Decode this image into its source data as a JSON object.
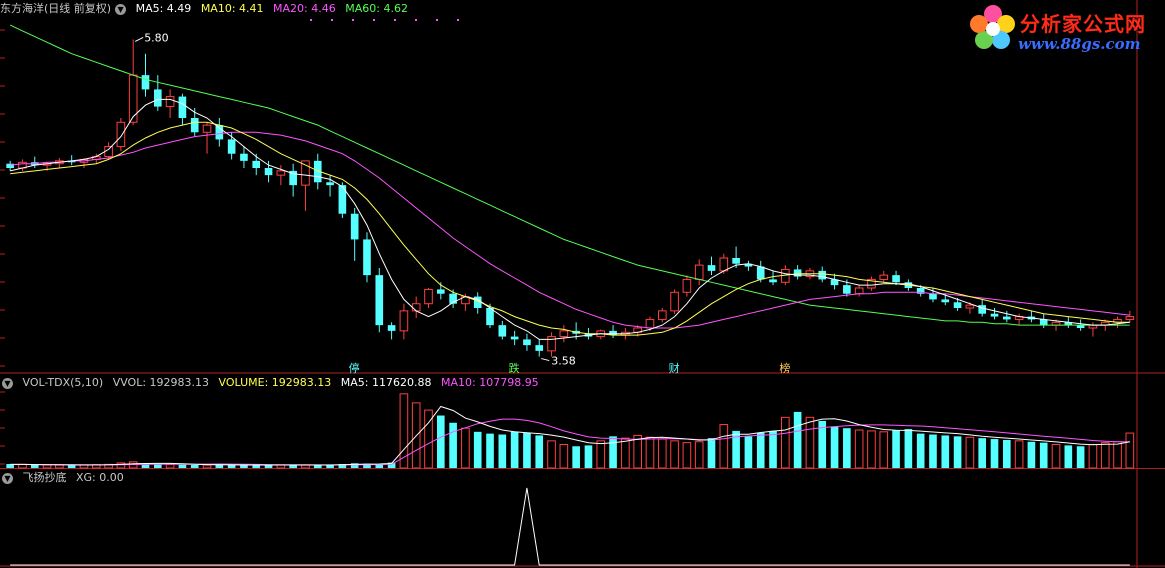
{
  "header": {
    "stock": "东方海洋(日线 前复权)",
    "ma5": "MA5: 4.49",
    "ma10": "MA10: 4.41",
    "ma20": "MA20: 4.46",
    "ma60": "MA60: 4.62"
  },
  "vol_header": {
    "name": "VOL-TDX(5,10)",
    "vvol": "VVOL: 192983.13",
    "volume": "VOLUME: 192983.13",
    "ma5": "MA5: 117620.88",
    "ma10": "MA10: 107798.95"
  },
  "ind_header": {
    "name": "飞扬抄底",
    "xg": "XG: 0.00"
  },
  "logo": {
    "title": "分析家公式网",
    "url": "www.88gs.com"
  },
  "markers": [
    {
      "label": "停",
      "color": "#55ffff"
    },
    {
      "label": "跌",
      "color": "#55ff55"
    },
    {
      "label": "财",
      "color": "#55ffff"
    },
    {
      "label": "榜",
      "color": "#ffcc55"
    }
  ],
  "annotations": {
    "high": "5.80",
    "low": "3.58"
  },
  "colors": {
    "up": "#ff4040",
    "down": "#55ffff",
    "ma5": "#ffffff",
    "ma10": "#ffff55",
    "ma20": "#ff55ff",
    "ma60": "#55ff55"
  },
  "chart_data": {
    "type": "candlestick",
    "price_range": [
      3.5,
      5.95
    ],
    "volume_range": [
      0,
      420000
    ],
    "indicator_range": [
      0,
      1
    ],
    "candles": [
      [
        4.93,
        4.95,
        4.88,
        4.9
      ],
      [
        4.9,
        4.96,
        4.88,
        4.94
      ],
      [
        4.94,
        4.98,
        4.9,
        4.92
      ],
      [
        4.92,
        4.94,
        4.88,
        4.93
      ],
      [
        4.93,
        4.97,
        4.9,
        4.95
      ],
      [
        4.95,
        4.99,
        4.92,
        4.94
      ],
      [
        4.94,
        4.97,
        4.9,
        4.96
      ],
      [
        4.96,
        5.0,
        4.93,
        4.98
      ],
      [
        4.98,
        5.08,
        4.96,
        5.05
      ],
      [
        5.05,
        5.25,
        5.02,
        5.22
      ],
      [
        5.22,
        5.8,
        5.2,
        5.55
      ],
      [
        5.55,
        5.7,
        5.4,
        5.45
      ],
      [
        5.45,
        5.55,
        5.3,
        5.33
      ],
      [
        5.33,
        5.45,
        5.25,
        5.4
      ],
      [
        5.4,
        5.42,
        5.2,
        5.25
      ],
      [
        5.25,
        5.32,
        5.12,
        5.15
      ],
      [
        5.15,
        5.22,
        5.0,
        5.2
      ],
      [
        5.2,
        5.25,
        5.05,
        5.1
      ],
      [
        5.1,
        5.15,
        4.96,
        5.0
      ],
      [
        5.0,
        5.05,
        4.9,
        4.95
      ],
      [
        4.95,
        5.0,
        4.85,
        4.9
      ],
      [
        4.9,
        4.95,
        4.8,
        4.85
      ],
      [
        4.85,
        4.92,
        4.78,
        4.88
      ],
      [
        4.88,
        4.93,
        4.7,
        4.78
      ],
      [
        4.78,
        4.85,
        4.6,
        4.95
      ],
      [
        4.95,
        5.0,
        4.75,
        4.8
      ],
      [
        4.8,
        4.85,
        4.7,
        4.78
      ],
      [
        4.78,
        4.8,
        4.55,
        4.58
      ],
      [
        4.58,
        4.62,
        4.25,
        4.4
      ],
      [
        4.4,
        4.45,
        4.1,
        4.15
      ],
      [
        4.15,
        4.2,
        3.75,
        3.8
      ],
      [
        3.8,
        3.82,
        3.7,
        3.76
      ],
      [
        3.76,
        3.95,
        3.7,
        3.9
      ],
      [
        3.9,
        4.0,
        3.85,
        3.95
      ],
      [
        3.95,
        4.06,
        3.92,
        4.05
      ],
      [
        4.05,
        4.1,
        3.98,
        4.02
      ],
      [
        4.02,
        4.05,
        3.92,
        3.95
      ],
      [
        3.95,
        4.02,
        3.9,
        4.0
      ],
      [
        4.0,
        4.03,
        3.88,
        3.92
      ],
      [
        3.92,
        3.95,
        3.78,
        3.8
      ],
      [
        3.8,
        3.83,
        3.7,
        3.72
      ],
      [
        3.72,
        3.76,
        3.66,
        3.7
      ],
      [
        3.7,
        3.74,
        3.62,
        3.66
      ],
      [
        3.66,
        3.7,
        3.58,
        3.62
      ],
      [
        3.62,
        3.75,
        3.58,
        3.72
      ],
      [
        3.72,
        3.8,
        3.68,
        3.76
      ],
      [
        3.76,
        3.82,
        3.7,
        3.74
      ],
      [
        3.74,
        3.78,
        3.7,
        3.72
      ],
      [
        3.72,
        3.77,
        3.7,
        3.76
      ],
      [
        3.76,
        3.8,
        3.71,
        3.73
      ],
      [
        3.73,
        3.78,
        3.7,
        3.75
      ],
      [
        3.75,
        3.8,
        3.72,
        3.78
      ],
      [
        3.78,
        3.86,
        3.76,
        3.84
      ],
      [
        3.84,
        3.92,
        3.82,
        3.9
      ],
      [
        3.9,
        4.05,
        3.88,
        4.03
      ],
      [
        4.03,
        4.15,
        4.0,
        4.12
      ],
      [
        4.12,
        4.26,
        4.08,
        4.22
      ],
      [
        4.22,
        4.28,
        4.15,
        4.18
      ],
      [
        4.18,
        4.3,
        4.16,
        4.27
      ],
      [
        4.27,
        4.35,
        4.2,
        4.23
      ],
      [
        4.23,
        4.25,
        4.18,
        4.21
      ],
      [
        4.21,
        4.25,
        4.1,
        4.12
      ],
      [
        4.12,
        4.18,
        4.08,
        4.1
      ],
      [
        4.1,
        4.22,
        4.08,
        4.19
      ],
      [
        4.19,
        4.22,
        4.12,
        4.14
      ],
      [
        4.14,
        4.2,
        4.12,
        4.18
      ],
      [
        4.18,
        4.21,
        4.1,
        4.12
      ],
      [
        4.12,
        4.16,
        4.05,
        4.08
      ],
      [
        4.08,
        4.12,
        4.0,
        4.02
      ],
      [
        4.02,
        4.08,
        4.0,
        4.06
      ],
      [
        4.06,
        4.14,
        4.04,
        4.12
      ],
      [
        4.12,
        4.18,
        4.1,
        4.15
      ],
      [
        4.15,
        4.18,
        4.08,
        4.1
      ],
      [
        4.1,
        4.12,
        4.04,
        4.06
      ],
      [
        4.06,
        4.08,
        4.0,
        4.02
      ],
      [
        4.02,
        4.06,
        3.96,
        3.98
      ],
      [
        3.98,
        4.02,
        3.94,
        3.96
      ],
      [
        3.96,
        3.99,
        3.9,
        3.92
      ],
      [
        3.92,
        3.96,
        3.88,
        3.94
      ],
      [
        3.94,
        3.98,
        3.86,
        3.88
      ],
      [
        3.88,
        3.92,
        3.84,
        3.86
      ],
      [
        3.86,
        3.9,
        3.82,
        3.84
      ],
      [
        3.84,
        3.88,
        3.8,
        3.86
      ],
      [
        3.86,
        3.9,
        3.82,
        3.84
      ],
      [
        3.84,
        3.88,
        3.78,
        3.8
      ],
      [
        3.8,
        3.84,
        3.76,
        3.82
      ],
      [
        3.82,
        3.86,
        3.78,
        3.8
      ],
      [
        3.8,
        3.84,
        3.76,
        3.78
      ],
      [
        3.78,
        3.82,
        3.72,
        3.8
      ],
      [
        3.8,
        3.84,
        3.76,
        3.82
      ],
      [
        3.82,
        3.86,
        3.78,
        3.84
      ],
      [
        3.84,
        3.9,
        3.82,
        3.86
      ]
    ],
    "ma5": [
      4.88,
      4.9,
      4.92,
      4.93,
      4.94,
      4.95,
      4.96,
      4.98,
      5.03,
      5.12,
      5.26,
      5.34,
      5.38,
      5.38,
      5.35,
      5.29,
      5.25,
      5.18,
      5.12,
      5.05,
      4.98,
      4.92,
      4.89,
      4.86,
      4.85,
      4.84,
      4.82,
      4.77,
      4.65,
      4.5,
      4.3,
      4.12,
      3.98,
      3.9,
      3.86,
      3.9,
      3.96,
      4.0,
      3.98,
      3.92,
      3.86,
      3.8,
      3.76,
      3.7,
      3.7,
      3.71,
      3.72,
      3.73,
      3.74,
      3.74,
      3.74,
      3.75,
      3.77,
      3.8,
      3.86,
      3.95,
      4.06,
      4.13,
      4.18,
      4.22,
      4.23,
      4.21,
      4.18,
      4.16,
      4.15,
      4.15,
      4.14,
      4.12,
      4.1,
      4.08,
      4.08,
      4.09,
      4.09,
      4.09,
      4.07,
      4.04,
      4.01,
      3.98,
      3.95,
      3.92,
      3.9,
      3.88,
      3.86,
      3.85,
      3.84,
      3.83,
      3.82,
      3.81,
      3.8,
      3.8,
      3.81,
      3.82
    ],
    "ma10": [
      4.86,
      4.87,
      4.88,
      4.89,
      4.9,
      4.91,
      4.92,
      4.93,
      4.96,
      5.0,
      5.06,
      5.11,
      5.15,
      5.18,
      5.2,
      5.22,
      5.22,
      5.2,
      5.18,
      5.14,
      5.1,
      5.05,
      5.0,
      4.96,
      4.92,
      4.88,
      4.85,
      4.82,
      4.76,
      4.68,
      4.58,
      4.47,
      4.36,
      4.26,
      4.16,
      4.08,
      4.03,
      4.0,
      3.97,
      3.93,
      3.9,
      3.86,
      3.83,
      3.8,
      3.78,
      3.77,
      3.75,
      3.74,
      3.74,
      3.73,
      3.73,
      3.73,
      3.74,
      3.75,
      3.78,
      3.83,
      3.89,
      3.95,
      4.0,
      4.05,
      4.09,
      4.12,
      4.14,
      4.15,
      4.16,
      4.16,
      4.16,
      4.15,
      4.14,
      4.12,
      4.11,
      4.1,
      4.09,
      4.08,
      4.07,
      4.06,
      4.04,
      4.02,
      4.0,
      3.98,
      3.96,
      3.94,
      3.92,
      3.9,
      3.88,
      3.87,
      3.86,
      3.85,
      3.84,
      3.83,
      3.82,
      3.82
    ],
    "ma20": [
      4.92,
      4.93,
      4.93,
      4.94,
      4.94,
      4.95,
      4.95,
      4.96,
      4.97,
      4.99,
      5.01,
      5.04,
      5.06,
      5.08,
      5.1,
      5.12,
      5.13,
      5.14,
      5.15,
      5.15,
      5.15,
      5.14,
      5.13,
      5.11,
      5.09,
      5.06,
      5.03,
      5.0,
      4.95,
      4.89,
      4.83,
      4.76,
      4.69,
      4.62,
      4.55,
      4.48,
      4.41,
      4.35,
      4.29,
      4.23,
      4.18,
      4.13,
      4.08,
      4.03,
      3.99,
      3.95,
      3.91,
      3.88,
      3.85,
      3.82,
      3.8,
      3.79,
      3.78,
      3.78,
      3.78,
      3.79,
      3.8,
      3.82,
      3.84,
      3.86,
      3.88,
      3.9,
      3.92,
      3.94,
      3.96,
      3.98,
      3.99,
      4.0,
      4.01,
      4.02,
      4.02,
      4.03,
      4.03,
      4.03,
      4.03,
      4.02,
      4.02,
      4.01,
      4.0,
      3.99,
      3.98,
      3.97,
      3.96,
      3.95,
      3.94,
      3.93,
      3.92,
      3.91,
      3.9,
      3.89,
      3.88,
      3.87
    ],
    "ma60": [
      5.9,
      5.86,
      5.82,
      5.78,
      5.74,
      5.7,
      5.67,
      5.64,
      5.61,
      5.58,
      5.55,
      5.52,
      5.5,
      5.48,
      5.46,
      5.44,
      5.42,
      5.4,
      5.38,
      5.36,
      5.34,
      5.32,
      5.29,
      5.26,
      5.23,
      5.2,
      5.16,
      5.12,
      5.08,
      5.04,
      5.0,
      4.96,
      4.92,
      4.88,
      4.84,
      4.8,
      4.76,
      4.72,
      4.68,
      4.64,
      4.6,
      4.56,
      4.52,
      4.48,
      4.44,
      4.4,
      4.37,
      4.34,
      4.31,
      4.28,
      4.25,
      4.22,
      4.2,
      4.18,
      4.16,
      4.14,
      4.12,
      4.1,
      4.08,
      4.06,
      4.04,
      4.02,
      4.0,
      3.98,
      3.96,
      3.94,
      3.93,
      3.92,
      3.91,
      3.9,
      3.89,
      3.88,
      3.87,
      3.86,
      3.85,
      3.84,
      3.83,
      3.83,
      3.82,
      3.82,
      3.81,
      3.81,
      3.8,
      3.8,
      3.8,
      3.8,
      3.8,
      3.8,
      3.8,
      3.8,
      3.8,
      3.8
    ],
    "volume": [
      22000,
      20000,
      18000,
      17000,
      16000,
      15000,
      17000,
      18000,
      20000,
      28000,
      34000,
      25000,
      22000,
      20000,
      18000,
      17000,
      16000,
      17000,
      18000,
      16000,
      15000,
      16000,
      17000,
      18000,
      16000,
      15000,
      18000,
      22000,
      26000,
      24000,
      20000,
      30000,
      410000,
      360000,
      320000,
      290000,
      250000,
      220000,
      200000,
      190000,
      185000,
      200000,
      195000,
      180000,
      150000,
      130000,
      120000,
      125000,
      150000,
      175000,
      165000,
      180000,
      170000,
      160000,
      150000,
      140000,
      145000,
      165000,
      240000,
      205000,
      175000,
      195000,
      205000,
      280000,
      310000,
      280000,
      260000,
      230000,
      220000,
      210000,
      205000,
      200000,
      210000,
      215000,
      190000,
      185000,
      180000,
      175000,
      170000,
      165000,
      160000,
      155000,
      150000,
      145000,
      140000,
      130000,
      125000,
      120000,
      130000,
      140000,
      145000,
      192983
    ],
    "vol_ma5": [
      20000,
      20000,
      19000,
      18500,
      18000,
      17000,
      16500,
      17000,
      17500,
      20000,
      23000,
      25000,
      25500,
      25500,
      24000,
      20500,
      18600,
      17600,
      17200,
      16800,
      16400,
      16400,
      16400,
      16400,
      16400,
      16400,
      16600,
      17800,
      20000,
      21600,
      22000,
      25000,
      103000,
      178000,
      250000,
      340000,
      318000,
      276000,
      255000,
      230000,
      210000,
      200000,
      195000,
      190000,
      182000,
      171000,
      155000,
      140000,
      135000,
      140000,
      148000,
      159000,
      168000,
      170000,
      165000,
      160000,
      154000,
      156000,
      176000,
      186000,
      186000,
      196000,
      204000,
      210000,
      233000,
      254000,
      270000,
      272000,
      260000,
      240000,
      225000,
      213000,
      209000,
      208000,
      204000,
      199000,
      194000,
      190000,
      183000,
      175000,
      170000,
      165000,
      160000,
      155000,
      150000,
      144000,
      138000,
      132000,
      129000,
      131000,
      132000,
      145000
    ],
    "vol_ma10": [
      20000,
      20000,
      19500,
      19000,
      18500,
      18000,
      17500,
      17300,
      17200,
      18000,
      19200,
      20000,
      20500,
      20800,
      21000,
      21500,
      21800,
      22000,
      21800,
      21000,
      20000,
      19000,
      18500,
      18000,
      17600,
      17200,
      17000,
      17200,
      17800,
      18500,
      19200,
      20600,
      59000,
      98000,
      135000,
      170000,
      200000,
      222000,
      245000,
      258000,
      270000,
      270000,
      263000,
      249000,
      228000,
      205000,
      188000,
      172000,
      165000,
      163000,
      160000,
      158000,
      160000,
      162000,
      162000,
      160000,
      157000,
      155000,
      162000,
      172000,
      177000,
      181000,
      184000,
      192000,
      204000,
      215000,
      223000,
      229000,
      234000,
      237000,
      238000,
      238000,
      236000,
      234000,
      232000,
      228000,
      222000,
      217000,
      211000,
      206000,
      200000,
      194000,
      188000,
      182000,
      176000,
      170000,
      164000,
      158000,
      152000,
      148000,
      145000,
      145000
    ],
    "xg": [
      0,
      0,
      0,
      0,
      0,
      0,
      0,
      0,
      0,
      0,
      0,
      0,
      0,
      0,
      0,
      0,
      0,
      0,
      0,
      0,
      0,
      0,
      0,
      0,
      0,
      0,
      0,
      0,
      0,
      0,
      0,
      0,
      0,
      0,
      0,
      0,
      0,
      0,
      0,
      0,
      0,
      0,
      1,
      0,
      0,
      0,
      0,
      0,
      0,
      0,
      0,
      0,
      0,
      0,
      0,
      0,
      0,
      0,
      0,
      0,
      0,
      0,
      0,
      0,
      0,
      0,
      0,
      0,
      0,
      0,
      0,
      0,
      0,
      0,
      0,
      0,
      0,
      0,
      0,
      0,
      0,
      0,
      0,
      0,
      0,
      0,
      0,
      0,
      0,
      0,
      0,
      0
    ],
    "high_index": 10,
    "low_index": 43,
    "marker_indices": [
      28,
      41,
      54,
      63
    ]
  }
}
